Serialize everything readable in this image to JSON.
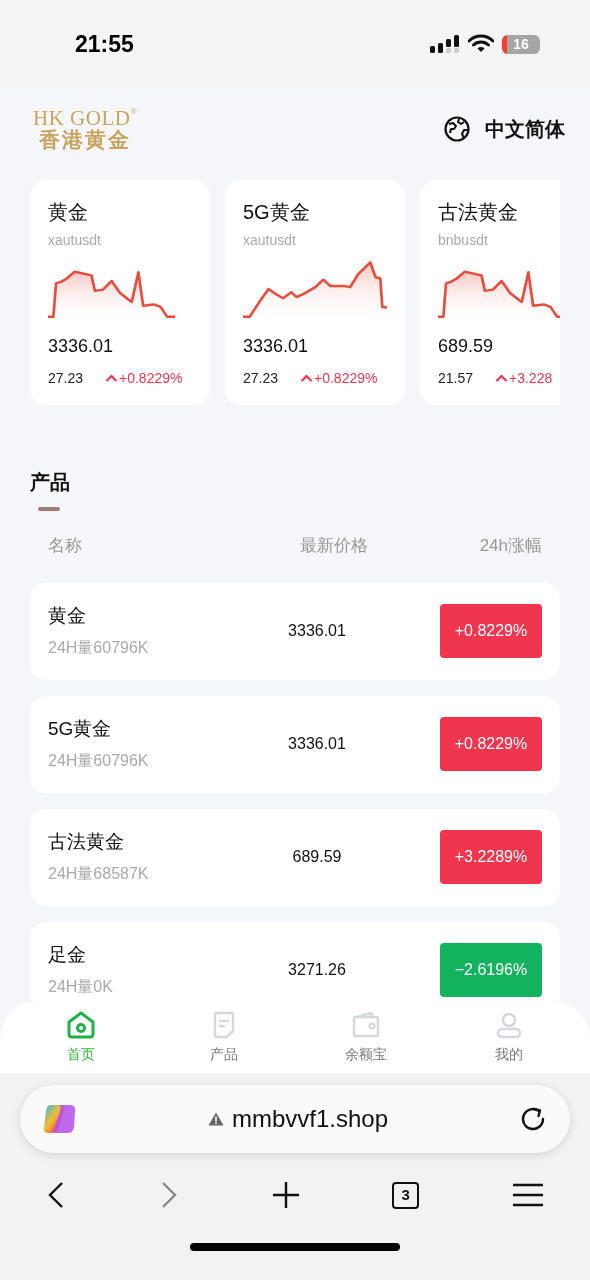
{
  "status_bar": {
    "time": "21:55",
    "battery": "16"
  },
  "header": {
    "logo_en": "HK GOLD",
    "logo_mark": "®",
    "logo_cn": "香港黄金",
    "language": "中文简体"
  },
  "tickers": [
    {
      "name": "黄金",
      "symbol": "xautusdt",
      "price": "3336.01",
      "volume": "27.23",
      "change": "+0.8229%",
      "kind": "up"
    },
    {
      "name": "5G黄金",
      "symbol": "xautusdt",
      "price": "3336.01",
      "volume": "27.23",
      "change": "+0.8229%",
      "kind": "up"
    },
    {
      "name": "古法黄金",
      "symbol": "bnbusdt",
      "price": "689.59",
      "volume": "21.57",
      "change": "+3.228",
      "kind": "up"
    }
  ],
  "products": {
    "title": "产品",
    "columns": [
      "名称",
      "最新价格",
      "24h涨幅"
    ],
    "rows": [
      {
        "name": "黄金",
        "volume": "24H量60796K",
        "price": "3336.01",
        "change": "+0.8229%",
        "kind": "up"
      },
      {
        "name": "5G黄金",
        "volume": "24H量60796K",
        "price": "3336.01",
        "change": "+0.8229%",
        "kind": "up"
      },
      {
        "name": "古法黄金",
        "volume": "24H量68587K",
        "price": "689.59",
        "change": "+3.2289%",
        "kind": "up"
      },
      {
        "name": "足金",
        "volume": "24H量0K",
        "price": "3271.26",
        "change": "−2.6196%",
        "kind": "down"
      }
    ]
  },
  "tab_bar": [
    {
      "label": "首页",
      "kind": "home",
      "selected": true
    },
    {
      "label": "产品",
      "kind": "doc",
      "selected": false
    },
    {
      "label": "余额宝",
      "kind": "wallet",
      "selected": false
    },
    {
      "label": "我的",
      "kind": "user",
      "selected": false
    }
  ],
  "browser": {
    "url": "mmbvvf1.shop",
    "tab_count": "3"
  }
}
